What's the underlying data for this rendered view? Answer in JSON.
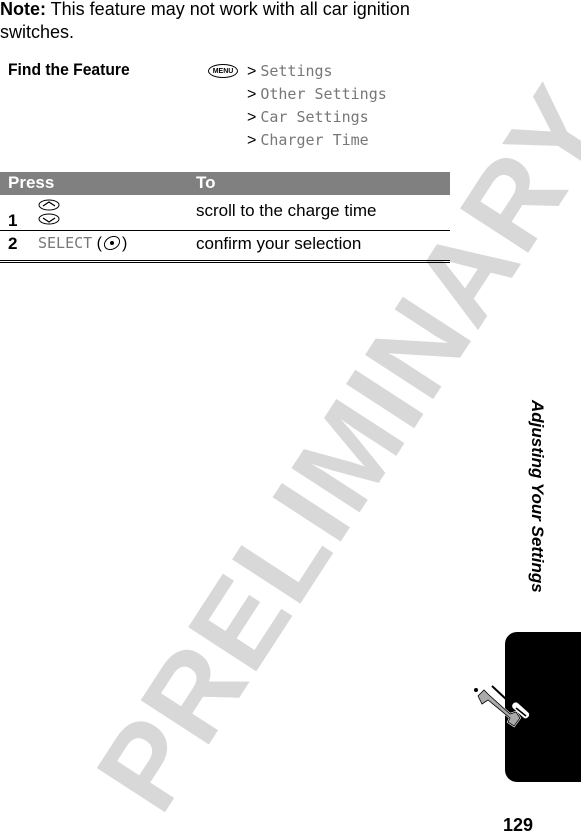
{
  "note": {
    "label": "Note:",
    "text": " This feature may not work with all car ignition switches."
  },
  "find_feature": {
    "label": "Find the Feature",
    "menu_key": "MENU",
    "separator": ">",
    "path": [
      "Settings",
      "Other Settings",
      "Car Settings",
      "Charger Time"
    ]
  },
  "table": {
    "headers": {
      "press": "Press",
      "to": "To"
    },
    "rows": [
      {
        "num": "1",
        "press_icon": "scroll-up-down-icon",
        "to": "scroll to the charge time"
      },
      {
        "num": "2",
        "press_key": "SELECT",
        "press_icon": "select-key-icon",
        "to": "confirm your selection"
      }
    ]
  },
  "watermark": "PRELIMINARY",
  "side_title": "Adjusting Your Settings",
  "section_icon": "wrench-screwdriver-icon",
  "page_number": "129",
  "colors": {
    "header_bg": "#808080",
    "menu_text": "#777777",
    "watermark": "#d8d8d8",
    "tab": "#000000"
  }
}
